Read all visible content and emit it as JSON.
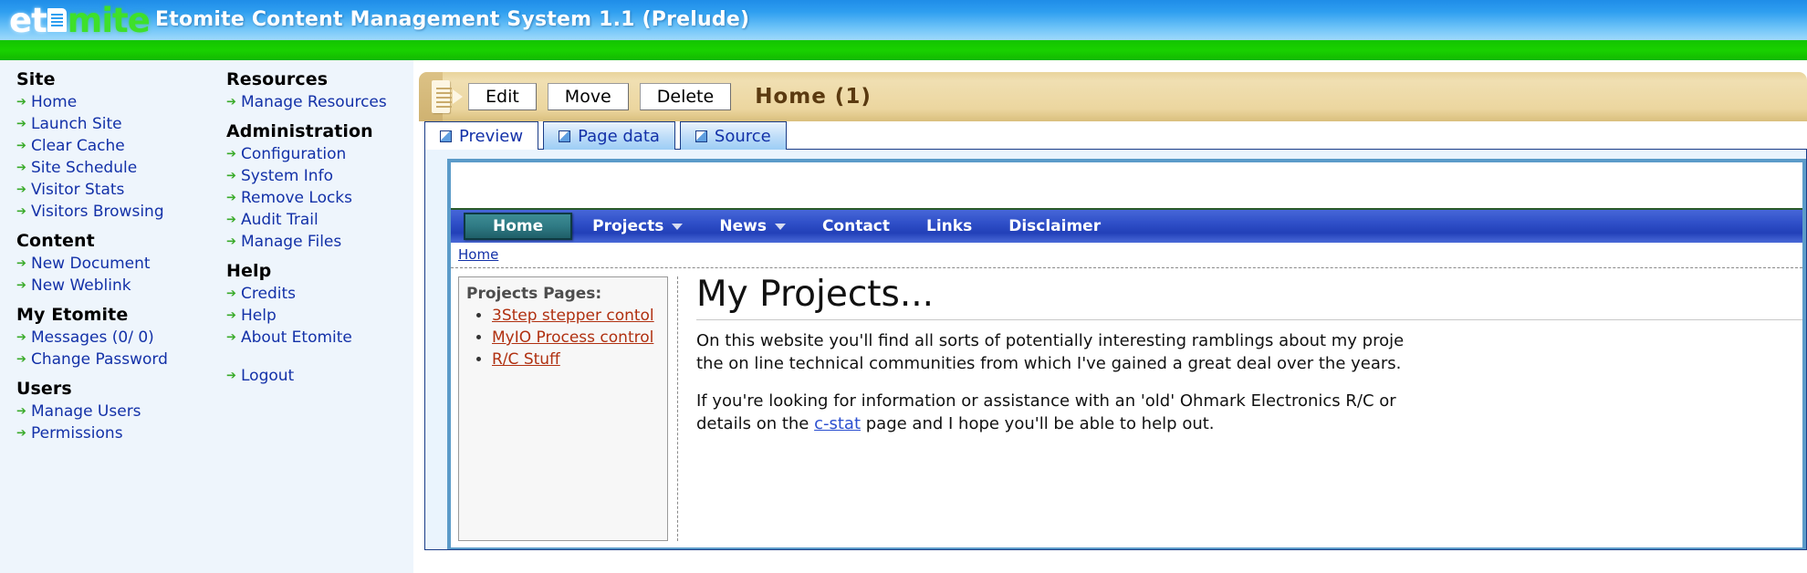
{
  "header": {
    "logo_part1": "et",
    "logo_icon": "document-icon",
    "logo_part2": "mite",
    "title": "Etomite Content Management System 1.1 (Prelude)",
    "brand_blue": "#2f9ff0",
    "brand_green": "#19d100"
  },
  "sidebar": {
    "groups": [
      {
        "heading": "Site",
        "items": [
          {
            "label": "Home"
          },
          {
            "label": "Launch Site"
          },
          {
            "label": "Clear Cache"
          },
          {
            "label": "Site Schedule"
          },
          {
            "label": "Visitor Stats"
          },
          {
            "label": "Visitors Browsing"
          }
        ]
      },
      {
        "heading": "Content",
        "items": [
          {
            "label": "New Document"
          },
          {
            "label": "New Weblink"
          }
        ]
      },
      {
        "heading": "My Etomite",
        "items": [
          {
            "label": "Messages (0/ 0)"
          },
          {
            "label": "Change Password"
          }
        ]
      },
      {
        "heading": "Users",
        "items": [
          {
            "label": "Manage Users"
          },
          {
            "label": "Permissions"
          }
        ]
      }
    ],
    "groups2": [
      {
        "heading": "Resources",
        "items": [
          {
            "label": "Manage Resources"
          }
        ]
      },
      {
        "heading": "Administration",
        "items": [
          {
            "label": "Configuration"
          },
          {
            "label": "System Info"
          },
          {
            "label": "Remove Locks"
          },
          {
            "label": "Audit Trail"
          },
          {
            "label": "Manage Files"
          }
        ]
      },
      {
        "heading": "Help",
        "items": [
          {
            "label": "Credits"
          },
          {
            "label": "Help"
          },
          {
            "label": "About Etomite"
          }
        ]
      }
    ],
    "logout": {
      "label": "Logout"
    },
    "bullet_glyph": "➔"
  },
  "toolbar": {
    "doc_icon": "document-play-icon",
    "edit_label": "Edit",
    "move_label": "Move",
    "delete_label": "Delete",
    "title": "Home  (1)"
  },
  "tabs": [
    {
      "label": "Preview",
      "active": true
    },
    {
      "label": "Page data",
      "active": false
    },
    {
      "label": "Source",
      "active": false
    }
  ],
  "preview": {
    "nav": [
      {
        "label": "Home",
        "active": true,
        "caret": false
      },
      {
        "label": "Projects",
        "active": false,
        "caret": true
      },
      {
        "label": "News",
        "active": false,
        "caret": true
      },
      {
        "label": "Contact",
        "active": false,
        "caret": false
      },
      {
        "label": "Links",
        "active": false,
        "caret": false
      },
      {
        "label": "Disclaimer",
        "active": false,
        "caret": false
      }
    ],
    "breadcrumb": "Home",
    "projects_box": {
      "title": "Projects Pages:",
      "links": [
        "3Step stepper contol",
        "MyIO Process control",
        "R/C Stuff "
      ]
    },
    "article": {
      "heading": "My Projects...",
      "paragraph1_line1": "On this website you'll find all sorts of potentially interesting ramblings about my proje",
      "paragraph1_line2": "the on line technical communities from which I've gained a great deal over the years.",
      "paragraph2_line1": "If you're looking for information or assistance with an 'old' Ohmark Electronics R/C or",
      "paragraph2_line2_pre": "details on the ",
      "paragraph2_link": "c-stat",
      "paragraph2_line2_post": " page and I hope you'll be able to help out."
    }
  }
}
